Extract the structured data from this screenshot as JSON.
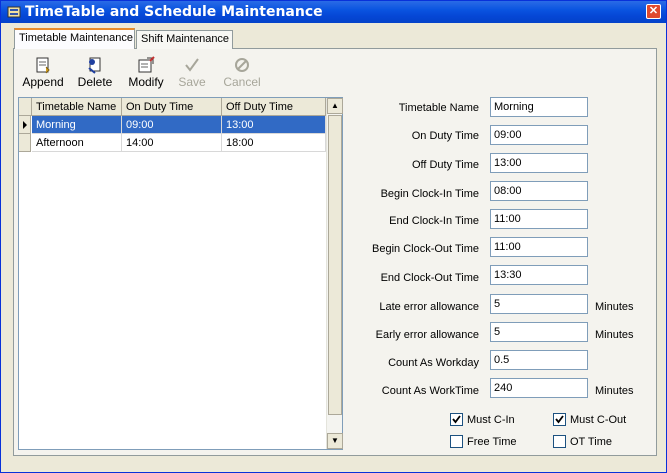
{
  "window": {
    "title": "TimeTable and Schedule Maintenance"
  },
  "tabs": [
    {
      "label": "Timetable Maintenance",
      "active": true
    },
    {
      "label": "Shift Maintenance",
      "active": false
    }
  ],
  "toolbar": {
    "append": "Append",
    "delete": "Delete",
    "modify": "Modify",
    "save": "Save",
    "cancel": "Cancel"
  },
  "grid": {
    "columns": [
      "Timetable Name",
      "On Duty Time",
      "Off Duty Time"
    ],
    "rows": [
      {
        "name": "Morning",
        "on": "09:00",
        "off": "13:00",
        "selected": true
      },
      {
        "name": "Afternoon",
        "on": "14:00",
        "off": "18:00",
        "selected": false
      }
    ]
  },
  "form": {
    "timetable_name": {
      "label": "Timetable Name",
      "value": "Morning"
    },
    "on_duty": {
      "label": "On Duty Time",
      "value": "09:00"
    },
    "off_duty": {
      "label": "Off Duty Time",
      "value": "13:00"
    },
    "begin_in": {
      "label": "Begin Clock-In Time",
      "value": "08:00"
    },
    "end_in": {
      "label": "End Clock-In Time",
      "value": "11:00"
    },
    "begin_out": {
      "label": "Begin Clock-Out Time",
      "value": "11:00"
    },
    "end_out": {
      "label": "End Clock-Out Time",
      "value": "13:30"
    },
    "late": {
      "label": "Late error allowance",
      "value": "5",
      "unit": "Minutes"
    },
    "early": {
      "label": "Early error allowance",
      "value": "5",
      "unit": "Minutes"
    },
    "workday": {
      "label": "Count As Workday",
      "value": "0.5"
    },
    "worktime": {
      "label": "Count As WorkTime",
      "value": "240",
      "unit": "Minutes"
    }
  },
  "checks": {
    "must_cin": {
      "label": "Must C-In",
      "checked": true
    },
    "must_cout": {
      "label": "Must C-Out",
      "checked": true
    },
    "free_time": {
      "label": "Free Time",
      "checked": false
    },
    "ot_time": {
      "label": "OT Time",
      "checked": false
    }
  }
}
